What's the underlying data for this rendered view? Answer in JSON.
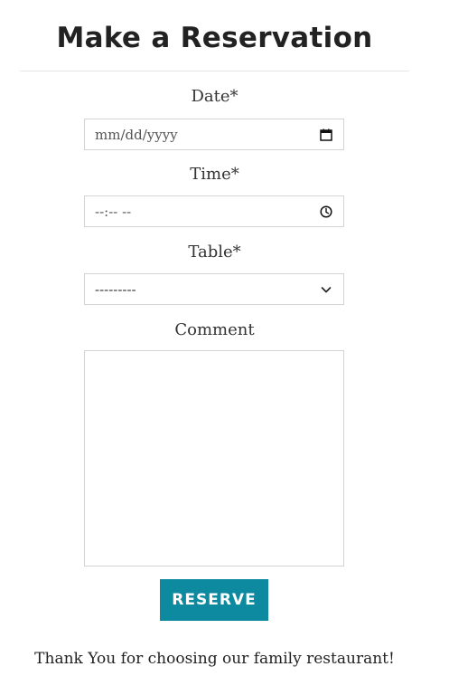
{
  "title": "Make a Reservation",
  "form": {
    "date": {
      "label": "Date*",
      "placeholder": "mm/dd/yyyy",
      "icon": "calendar-icon"
    },
    "time": {
      "label": "Time*",
      "placeholder": "--:-- --",
      "icon": "clock-icon"
    },
    "table": {
      "label": "Table*",
      "selected": "---------",
      "icon": "chevron-down-icon"
    },
    "comment": {
      "label": "Comment",
      "value": ""
    },
    "submit_label": "RESERVE"
  },
  "footer": {
    "message": "Thank You for choosing our family restaurant!"
  },
  "colors": {
    "accent": "#0e8aa0",
    "text": "#333333",
    "border": "#d4d4d4"
  }
}
